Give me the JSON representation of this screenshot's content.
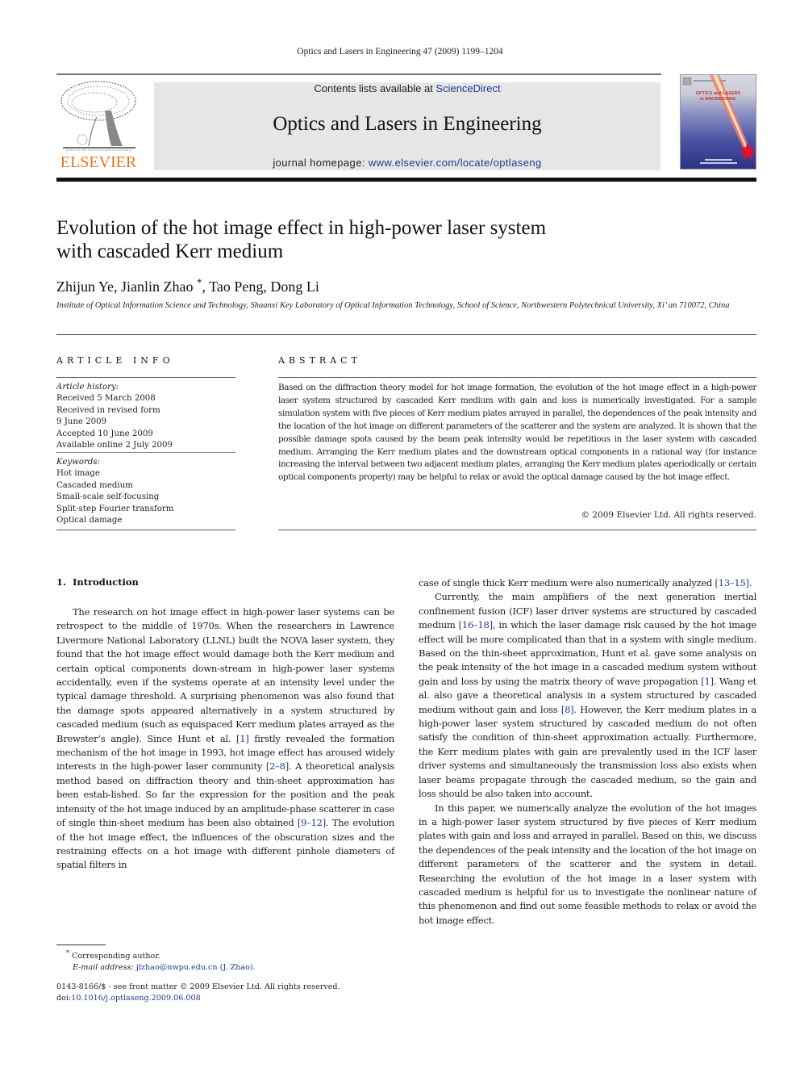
{
  "running_head": "Optics and Lasers in Engineering 47 (2009) 1199–1204",
  "masthead": {
    "publisher_logo_text": "ELSEVIER",
    "contents_prefix": "Contents lists available at ",
    "contents_link": "ScienceDirect",
    "journal_name": "Optics and Lasers in Engineering",
    "homepage_prefix": "journal homepage: ",
    "homepage_link": "www.elsevier.com/locate/optlaseng",
    "cover_title_line1": "OPTICS and LASERS",
    "cover_title_line2": "in ENGINEERING",
    "brand_color": "#e87722",
    "link_color": "#1f3a93"
  },
  "article": {
    "title_line1": "Evolution of the hot image effect in high-power laser system",
    "title_line2": "with cascaded Kerr medium",
    "authors_part1": "Zhijun Ye, Jianlin Zhao",
    "authors_mark": "*",
    "authors_part2": ", Tao Peng, Dong Li",
    "affiliation": "Institute of Optical Information Science and Technology, Shaanxi Key Laboratory of Optical Information Technology, School of Science, Northwestern Polytechnical University, Xi’ an 710072, China"
  },
  "article_info": {
    "label": "ARTICLE INFO",
    "history_label": "Article history:",
    "history": [
      "Received 5 March 2008",
      "Received in revised form",
      "9 June 2009",
      "Accepted 10 June 2009",
      "Available online 2 July 2009"
    ],
    "keywords_label": "Keywords:",
    "keywords": [
      "Hot image",
      "Cascaded medium",
      "Small-scale self-focusing",
      "Split-step Fourier transform",
      "Optical damage"
    ]
  },
  "abstract": {
    "label": "ABSTRACT",
    "text": "Based on the diffraction theory model for hot image formation, the evolution of the hot image effect in a high-power laser system structured by cascaded Kerr medium with gain and loss is numerically investigated. For a sample simulation system with five pieces of Kerr medium plates arrayed in parallel, the dependences of the peak intensity and the location of the hot image on different parameters of the scatterer and the system are analyzed. It is shown that the possible damage spots caused by the beam peak intensity would be repetitious in the laser system with cascaded medium. Arranging the Kerr medium plates and the downstream optical components in a rational way (for instance increasing the interval between two adjacent medium plates, arranging the Kerr medium plates aperiodically or certain optical components properly) may be helpful to relax or avoid the optical damage caused by the hot image effect.",
    "copyright": "© 2009 Elsevier Ltd. All rights reserved."
  },
  "introduction": {
    "number": "1.",
    "heading": "Introduction",
    "left_p1_a": "The research on hot image effect in high-power laser systems can be retrospect to the middle of 1970s. When the researchers in Lawrence Livermore National Laboratory (LLNL) built the NOVA laser system, they found that the hot image effect would damage both the Kerr medium and certain optical components down-stream in high-power laser systems accidentally, even if the systems operate at an intensity level under the typical damage threshold. A surprising phenomenon was also found that the damage spots appeared alternatively in a system structured by cascaded medium (such as equispaced Kerr medium plates arrayed as the Brewster’s angle). Since Hunt et al. ",
    "ref_1": "[1]",
    "left_p1_b": " firstly revealed the formation mechanism of the hot image in 1993, hot image effect has aroused widely interests in the high-power laser community ",
    "ref_2_8": "[2–8]",
    "left_p1_c": ". A theoretical analysis method based on diffraction theory and thin-sheet approximation has been estab-lished. So far the expression for the position and the peak intensity of the hot image induced by an amplitude-phase scatterer in case of single thin-sheet medium has been also obtained ",
    "ref_9_12": "[9–12]",
    "left_p1_d": ". The evolution of the hot image effect, the influences of the obscuration sizes and the restraining effects on a hot image with different pinhole diameters of spatial filters in",
    "right_p1_a": "case of single thick Kerr medium were also numerically analyzed ",
    "ref_13_15": "[13–15]",
    "right_p1_b": ".",
    "right_p2_a": "Currently, the main amplifiers of the next generation inertial confinement fusion (ICF) laser driver systems are structured by cascaded medium ",
    "ref_16_18": "[16–18]",
    "right_p2_b": ", in which the laser damage risk caused by the hot image effect will be more complicated than that in a system with single medium. Based on the thin-sheet approximation, Hunt et al. gave some analysis on the peak intensity of the hot image in a cascaded medium system without gain and loss by using the matrix theory of wave propagation ",
    "ref_1b": "[1]",
    "right_p2_c": ". Wang et al. also gave a theoretical analysis in a system structured by cascaded medium without gain and loss ",
    "ref_8": "[8]",
    "right_p2_d": ". However, the Kerr medium plates in a high-power laser system structured by cascaded medium do not often satisfy the condition of thin-sheet approximation actually. Furthermore, the Kerr medium plates with gain are prevalently used in the ICF laser driver systems and simultaneously the transmission loss also exists when laser beams propagate through the cascaded medium, so the gain and loss should be also taken into account.",
    "right_p3": "In this paper, we numerically analyze the evolution of the hot images in a high-power laser system structured by five pieces of Kerr medium plates with gain and loss and arrayed in parallel. Based on this, we discuss the dependences of the peak intensity and the location of the hot image on different parameters of the scatterer and the system in detail. Researching the evolution of the hot image in a laser system with cascaded medium is helpful for us to investigate the nonlinear nature of this phenomenon and find out some feasible methods to relax or avoid the hot image effect."
  },
  "footnote": {
    "mark": "*",
    "corresponding": " Corresponding author.",
    "email_label": "E-mail address:",
    "email": "jlzhao@nwpu.edu.cn",
    "email_name": " (J. Zhao)."
  },
  "front_matter": {
    "issn_line": "0143-8166/$ - see front matter © 2009 Elsevier Ltd. All rights reserved.",
    "doi_prefix": "doi:",
    "doi": "10.1016/j.optlaseng.2009.06.008"
  }
}
